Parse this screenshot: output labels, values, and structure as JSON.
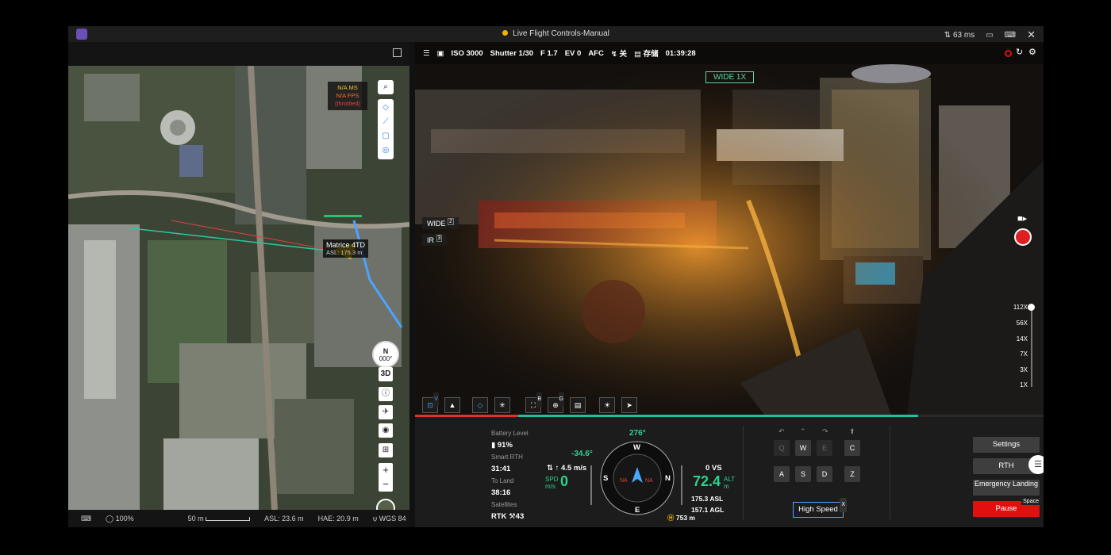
{
  "titlebar": {
    "title": "Live Flight Controls-Manual",
    "latency": "63 ms"
  },
  "map": {
    "perf_ms": "N/A MS",
    "perf_fps": "N/A FPS",
    "perf_note": "(throttled)",
    "drone_name": "Matrice 4TD",
    "drone_asl": "ASL: 175.3 m",
    "compass_letter": "N",
    "compass_heading": "000°",
    "btn_3d": "3D",
    "zoom_in": "+",
    "zoom_out": "−",
    "footer": {
      "zoom": "100%",
      "scale": "50 m",
      "asl": "ASL: 23.6 m",
      "hae": "HAE: 20.9 m",
      "datum": "WGS 84"
    }
  },
  "camera": {
    "iso": "ISO 3000",
    "shutter": "Shutter 1/30",
    "fstop": "F 1.7",
    "ev": "EV 0",
    "focus": "AFC",
    "flash": "关",
    "storage": "存储",
    "rec_time": "01:39:28",
    "lens_mode": "WIDE 1X",
    "lens_wide": "WIDE",
    "lens_wide_key": "2",
    "lens_ir": "IR",
    "lens_ir_key": "3",
    "zoom_levels": [
      "112X",
      "56X",
      "14X",
      "7X",
      "3X",
      "1X"
    ],
    "tool_badges": {
      "v": "V",
      "b": "B",
      "g": "G"
    }
  },
  "telemetry": {
    "progress_fraction": 0.8,
    "battery_label": "Battery Level",
    "battery": "91%",
    "rth_label": "Smart RTH",
    "rth_time": "31:41",
    "land_label": "To Land",
    "land_time": "38:16",
    "sat_label": "Satellites",
    "sat_value": "RTK ⚒43",
    "heading": "276°",
    "pitch": "-34.6°",
    "vspeed_up": "↑ 4.5 m/s",
    "spd_label": "SPD",
    "spd_unit": "m/s",
    "spd": "0",
    "vs": "0 VS",
    "alt": "72.4",
    "alt_label": "ALT",
    "alt_unit": "m",
    "asl": "175.3 ASL",
    "agl": "157.1 AGL",
    "dist": "753 m",
    "compass_letters": [
      "W",
      "S",
      "N",
      "E"
    ],
    "compass_na": "NA"
  },
  "keys": {
    "q": "Q",
    "w": "W",
    "e": "E",
    "c": "C",
    "a": "A",
    "s": "S",
    "d": "D",
    "z": "Z",
    "speed": "High Speed",
    "speed_x": "X"
  },
  "actions": {
    "settings": "Settings",
    "rth": "RTH",
    "emergency": "Emergency Landing",
    "pause": "Pause",
    "pause_key": "Space"
  },
  "colors": {
    "accent": "#2fd08f",
    "alert": "#e01010",
    "drone": "#f2d21b"
  }
}
